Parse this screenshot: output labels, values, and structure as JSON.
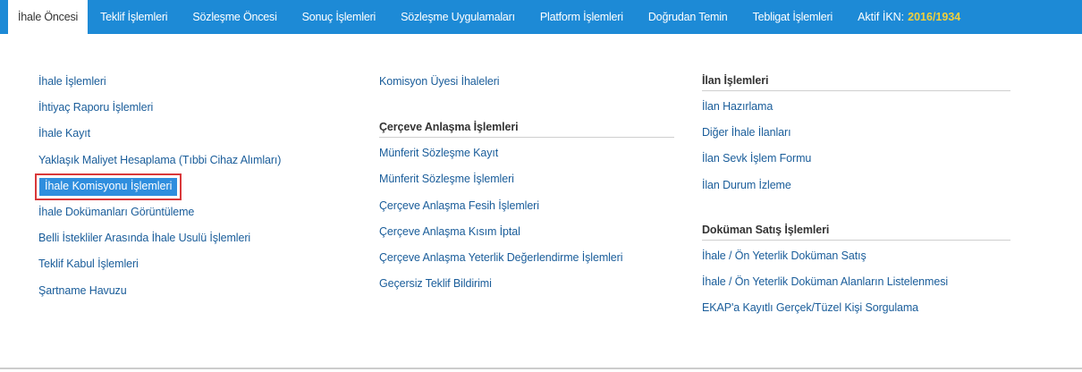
{
  "nav": {
    "items": [
      "İhale Öncesi",
      "Teklif İşlemleri",
      "Sözleşme Öncesi",
      "Sonuç İşlemleri",
      "Sözleşme Uygulamaları",
      "Platform İşlemleri",
      "Doğrudan Temin",
      "Tebligat İşlemleri"
    ],
    "ikn_label": "Aktif İKN:",
    "ikn_value": "2016/1934"
  },
  "col1": {
    "links": [
      "İhale İşlemleri",
      "İhtiyaç Raporu İşlemleri",
      "İhale Kayıt",
      "Yaklaşık Maliyet Hesaplama (Tıbbi Cihaz Alımları)",
      "İhale Komisyonu İşlemleri",
      "İhale Dokümanları Görüntüleme",
      "Belli İstekliler Arasında İhale Usulü İşlemleri",
      "Teklif Kabul İşlemleri",
      "Şartname Havuzu"
    ]
  },
  "col2": {
    "top_link": "Komisyon Üyesi İhaleleri",
    "section_title": "Çerçeve Anlaşma İşlemleri",
    "links": [
      "Münferit Sözleşme Kayıt",
      "Münferit Sözleşme İşlemleri",
      "Çerçeve Anlaşma Fesih İşlemleri",
      "Çerçeve Anlaşma Kısım İptal",
      "Çerçeve Anlaşma Yeterlik Değerlendirme İşlemleri",
      "Geçersiz Teklif Bildirimi"
    ]
  },
  "col3": {
    "section1_title": "İlan İşlemleri",
    "section1_links": [
      "İlan Hazırlama",
      "Diğer İhale İlanları",
      "İlan Sevk İşlem Formu",
      "İlan Durum İzleme"
    ],
    "section2_title": "Doküman Satış İşlemleri",
    "section2_links": [
      "İhale / Ön Yeterlik Doküman Satış",
      "İhale / Ön Yeterlik Doküman Alanların Listelenmesi",
      "EKAP'a Kayıtlı Gerçek/Tüzel Kişi Sorgulama"
    ]
  },
  "colors": {
    "nav_bg": "#1d8ad6",
    "link": "#1a5d9a",
    "highlight_bg": "#2f8ede",
    "highlight_border": "#d9383a",
    "ikn_value": "#f2d03b"
  }
}
